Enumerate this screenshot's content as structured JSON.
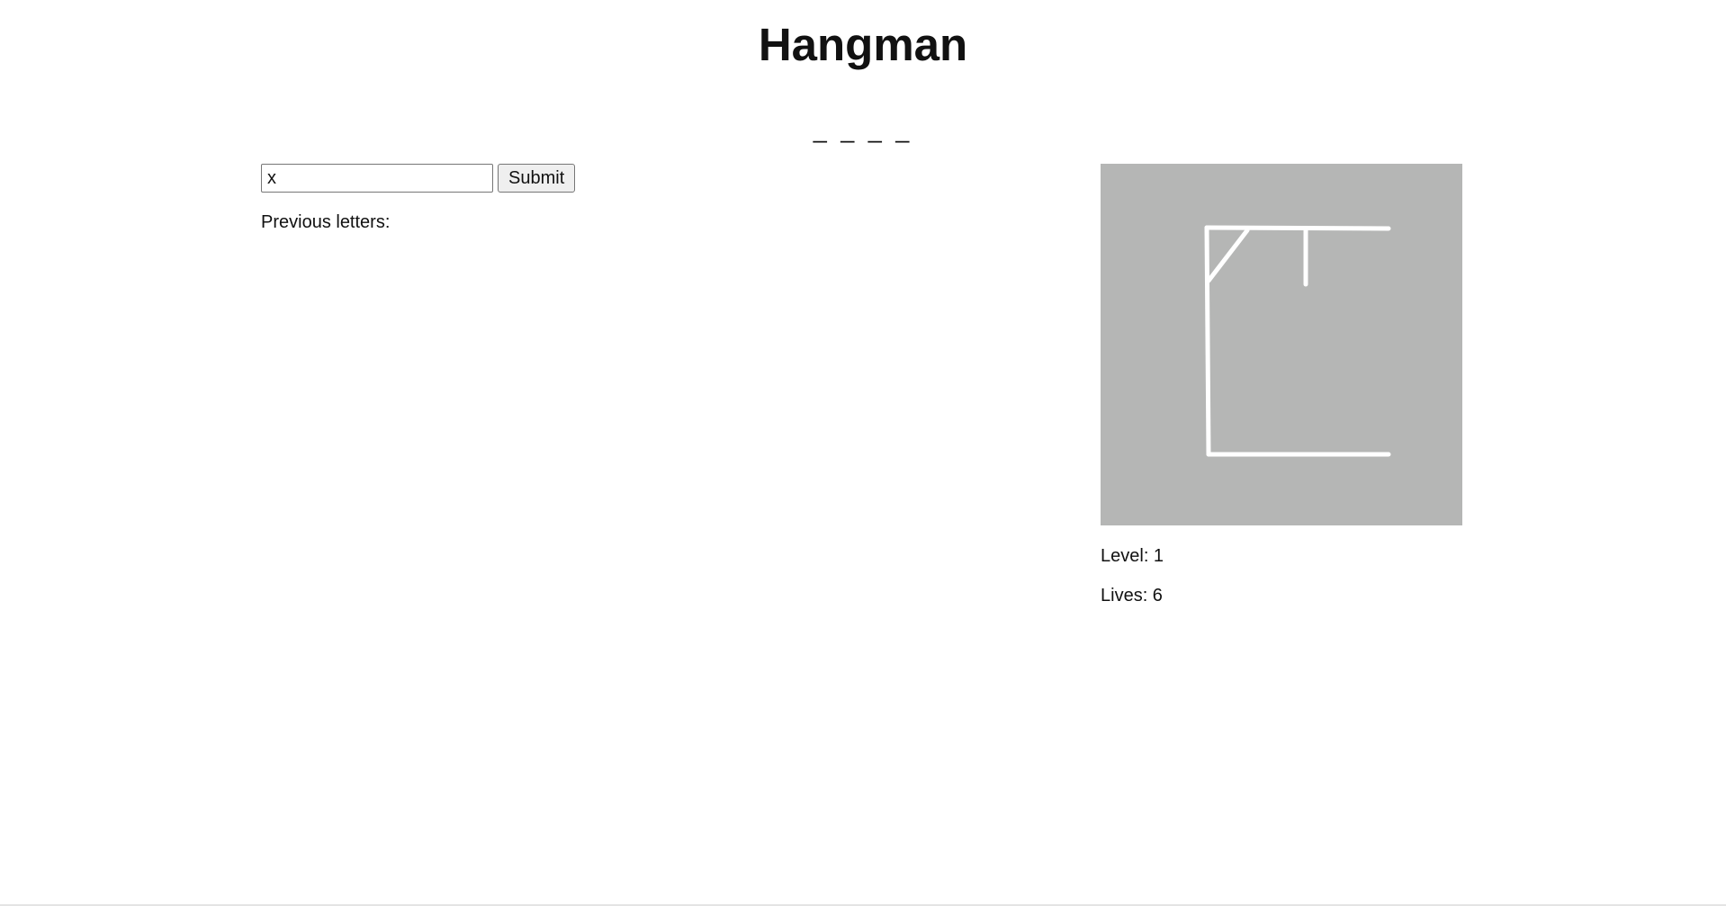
{
  "game": {
    "title": "Hangman",
    "masked_word": "_ _ _ _"
  },
  "guess": {
    "input_value": "x",
    "submit_label": "Submit"
  },
  "previous_letters": {
    "label": "Previous letters:"
  },
  "gallows": {
    "background_color": "#b5b6b5",
    "stroke_color": "#ffffff",
    "drawn_parts": [
      "base",
      "upright",
      "crossbeam",
      "brace",
      "rope"
    ]
  },
  "stats": {
    "level_label": "Level: 1",
    "lives_label": "Lives: 6"
  }
}
